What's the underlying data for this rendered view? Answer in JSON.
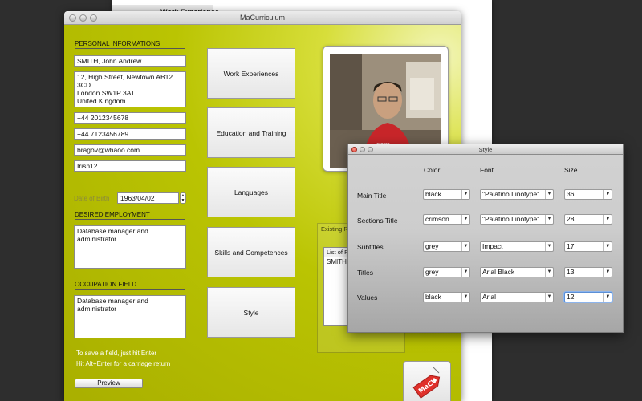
{
  "background_doc": {
    "title": "Work Experience"
  },
  "main_window": {
    "title": "MaCurriculum",
    "personal": {
      "heading": "PERSONAL INFORMATIONS",
      "name": "SMITH, John Andrew",
      "address": "12, High Street, Newtown AB12\n3CD\nLondon SW1P 3AT\nUnited Kingdom",
      "phone1": "+44 2012345678",
      "phone2": "+44 7123456789",
      "email": "bragov@whaoo.com",
      "nationality": "Irish12",
      "dob_label": "Date of Birth",
      "dob_value": "1963/04/02"
    },
    "desired_employment": {
      "heading": "DESIRED EMPLOYMENT",
      "value": "Database manager and\nadministrator"
    },
    "occupation_field": {
      "heading": "OCCUPATION FIELD",
      "value": "Database manager and\nadministrator"
    },
    "hints": [
      "To save a field, just hit Enter",
      "Hit Alt+Enter for a carriage return"
    ],
    "preview_label": "Preview",
    "buttons": [
      "Work Experiences",
      "Education and Training",
      "Languages",
      "Skills and Competences",
      "Style"
    ],
    "existing": {
      "label": "Existing R",
      "list_header": "List of R",
      "items": [
        "SMITH,"
      ]
    },
    "app_icon_text": "MaCV"
  },
  "style_panel": {
    "title": "Style",
    "columns": {
      "color": "Color",
      "font": "Font",
      "size": "Size"
    },
    "rows": [
      {
        "label": "Main Title",
        "color": "black",
        "font": "\"Palatino Linotype\"",
        "size": "36"
      },
      {
        "label": "Sections Title",
        "color": "crimson",
        "font": "\"Palatino Linotype\"",
        "size": "28"
      },
      {
        "label": "Subtitles",
        "color": "grey",
        "font": "Impact",
        "size": "17"
      },
      {
        "label": "Titles",
        "color": "grey",
        "font": "Arial Black",
        "size": "13"
      },
      {
        "label": "Values",
        "color": "black",
        "font": "Arial",
        "size": "12"
      }
    ]
  },
  "colors": {
    "accent_bg": "#bac402",
    "close_red": "#d43a2c",
    "app_icon_red": "#e0302a"
  }
}
